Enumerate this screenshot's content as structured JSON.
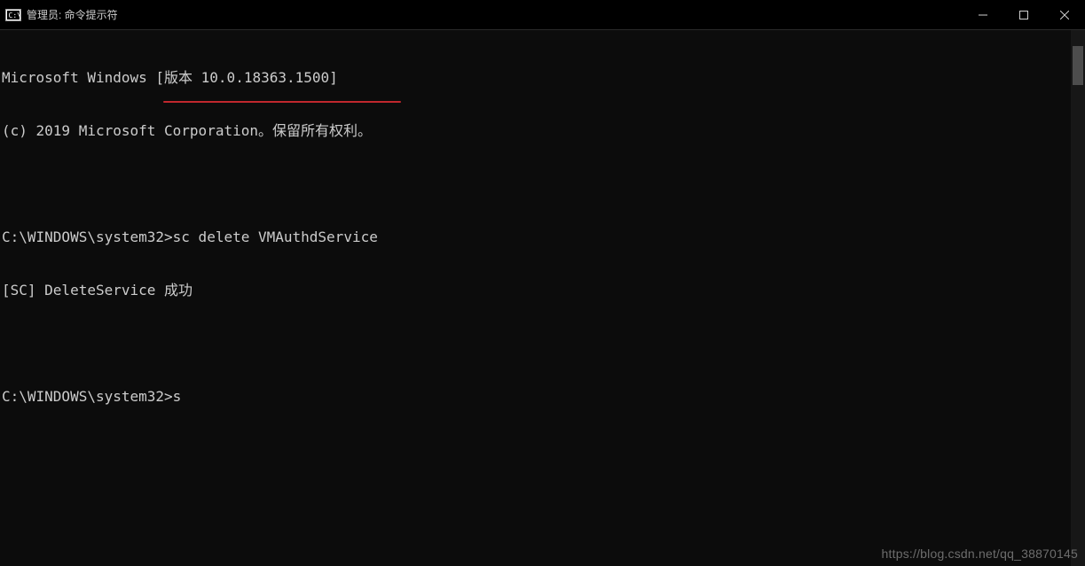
{
  "window": {
    "title": "管理员: 命令提示符"
  },
  "terminal": {
    "lines": [
      "Microsoft Windows [版本 10.0.18363.1500]",
      "(c) 2019 Microsoft Corporation。保留所有权利。",
      "",
      "C:\\WINDOWS\\system32>sc delete VMAuthdService",
      "[SC] DeleteService 成功",
      "",
      "C:\\WINDOWS\\system32>s"
    ]
  },
  "watermark": "https://blog.csdn.net/qq_38870145"
}
